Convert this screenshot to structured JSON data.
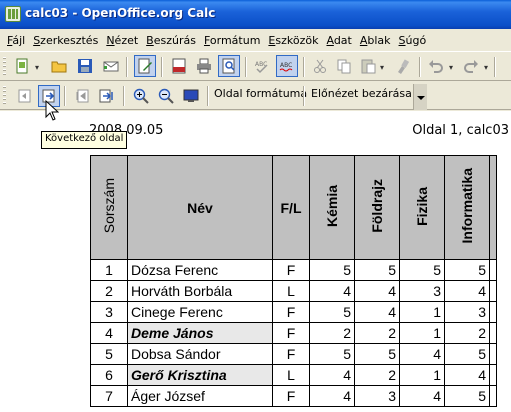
{
  "window": {
    "title": "calc03 - OpenOffice.org Calc"
  },
  "menu": [
    "Fájl",
    "Szerkesztés",
    "Nézet",
    "Beszúrás",
    "Formátum",
    "Eszközök",
    "Adat",
    "Ablak",
    "Súgó"
  ],
  "toolbar": {
    "icons": [
      "new-document-icon",
      "open-folder-icon",
      "save-icon",
      "email-icon",
      "edit-document-icon",
      "export-pdf-icon",
      "print-icon",
      "page-preview-icon",
      "spellcheck-icon",
      "autospellcheck-icon",
      "cut-icon",
      "copy-icon",
      "paste-icon",
      "format-paintbrush-icon",
      "undo-icon",
      "redo-icon"
    ]
  },
  "preview_toolbar": {
    "page_format_label": "Oldal formátuma",
    "close_preview_label": "Előnézet bezárása"
  },
  "tooltip": "Következő oldal",
  "page": {
    "header_left": "2008.09.05",
    "header_right": "Oldal 1, calc03"
  },
  "table": {
    "headers": {
      "sorszam": "Sorszám",
      "nev": "Név",
      "fl": "F/L",
      "subjects": [
        "Kémia",
        "Földrajz",
        "Fizika",
        "Informatika"
      ]
    },
    "rows": [
      {
        "num": "1",
        "name": "Dózsa Ferenc",
        "fl": "F",
        "grades": [
          "5",
          "5",
          "5",
          "5"
        ],
        "highlight": false
      },
      {
        "num": "2",
        "name": "Horváth Borbála",
        "fl": "L",
        "grades": [
          "4",
          "4",
          "3",
          "4"
        ],
        "highlight": false
      },
      {
        "num": "3",
        "name": "Cinege Ferenc",
        "fl": "F",
        "grades": [
          "5",
          "4",
          "1",
          "3"
        ],
        "highlight": false
      },
      {
        "num": "4",
        "name": "Deme János",
        "fl": "F",
        "grades": [
          "2",
          "2",
          "1",
          "2"
        ],
        "highlight": true
      },
      {
        "num": "5",
        "name": "Dobsa Sándor",
        "fl": "F",
        "grades": [
          "5",
          "5",
          "4",
          "5"
        ],
        "highlight": false
      },
      {
        "num": "6",
        "name": "Gerő Krisztina",
        "fl": "L",
        "grades": [
          "4",
          "2",
          "1",
          "4"
        ],
        "highlight": true
      },
      {
        "num": "7",
        "name": "Áger József",
        "fl": "F",
        "grades": [
          "4",
          "3",
          "4",
          "5"
        ],
        "highlight": false
      }
    ]
  }
}
